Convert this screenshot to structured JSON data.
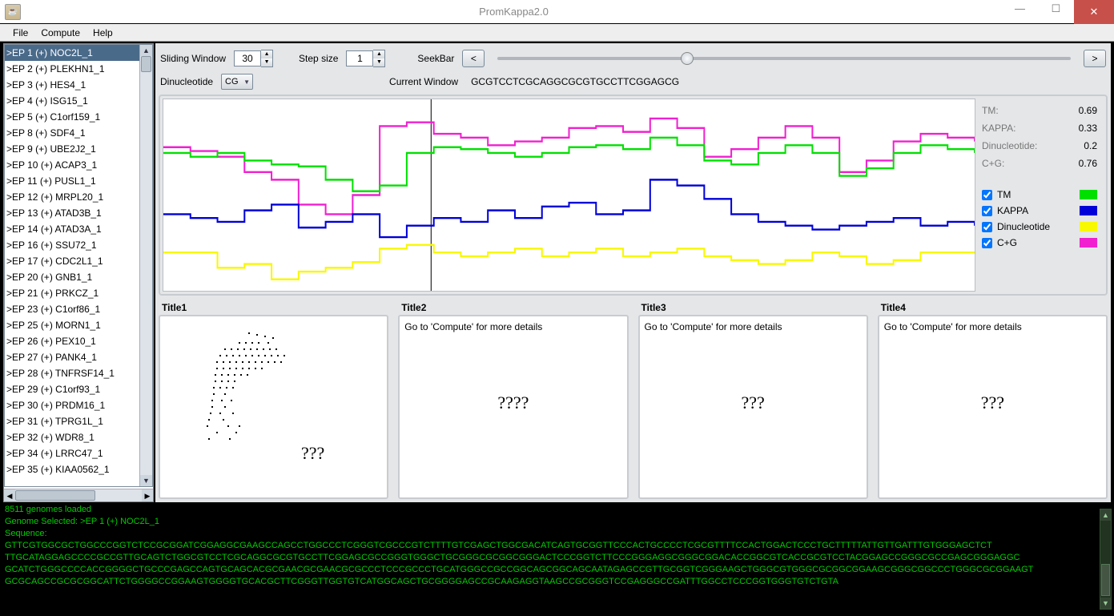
{
  "window": {
    "title": "PromKappa2.0"
  },
  "menu": {
    "file": "File",
    "compute": "Compute",
    "help": "Help"
  },
  "sidebar": {
    "items": [
      ">EP 1 (+) NOC2L_1",
      ">EP 2 (+) PLEKHN1_1",
      ">EP 3 (+) HES4_1",
      ">EP 4 (+) ISG15_1",
      ">EP 5 (+) C1orf159_1",
      ">EP 8 (+) SDF4_1",
      ">EP 9 (+) UBE2J2_1",
      ">EP 10 (+) ACAP3_1",
      ">EP 11 (+) PUSL1_1",
      ">EP 12 (+) MRPL20_1",
      ">EP 13 (+) ATAD3B_1",
      ">EP 14 (+) ATAD3A_1",
      ">EP 16 (+) SSU72_1",
      ">EP 17 (+) CDC2L1_1",
      ">EP 20 (+) GNB1_1",
      ">EP 21 (+) PRKCZ_1",
      ">EP 23 (+) C1orf86_1",
      ">EP 25 (+) MORN1_1",
      ">EP 26 (+) PEX10_1",
      ">EP 27 (+) PANK4_1",
      ">EP 28 (+) TNFRSF14_1",
      ">EP 29 (+) C1orf93_1",
      ">EP 30 (+) PRDM16_1",
      ">EP 31 (+) TPRG1L_1",
      ">EP 32 (+) WDR8_1",
      ">EP 34 (+) LRRC47_1",
      ">EP 35 (+) KIAA0562_1"
    ],
    "selected_index": 0
  },
  "controls": {
    "sliding_window_label": "Sliding Window",
    "sliding_window_value": "30",
    "step_label": "Step size",
    "step_value": "1",
    "seek_label": "SeekBar",
    "seek_prev": "<",
    "seek_next": ">",
    "dinucleotide_label": "Dinucleotide",
    "dinucleotide_value": "CG",
    "current_window_label": "Current Window",
    "current_window_value": "GCGTCCTCGCAGGCGCGTGCCTTCGGAGCG"
  },
  "metrics": {
    "tm_label": "TM:",
    "tm_value": "0.69",
    "kappa_label": "KAPPA:",
    "kappa_value": "0.33",
    "dinuc_label": "Dinucleotide:",
    "dinuc_value": "0.2",
    "cg_label": "C+G:",
    "cg_value": "0.76"
  },
  "legend": {
    "tm": "TM",
    "kappa": "KAPPA",
    "dinuc": "Dinucleotide",
    "cg": "C+G",
    "tm_color": "#00e000",
    "kappa_color": "#0000d8",
    "dinuc_color": "#f8f800",
    "cg_color": "#f020d0"
  },
  "panels": {
    "t1": "Title1",
    "t2": "Title2",
    "t3": "Title3",
    "t4": "Title4",
    "msg": "Go to 'Compute' for more details",
    "q4": "????",
    "q3a": "???",
    "q3b": "???",
    "q3c": "???"
  },
  "console": {
    "l0": "8511 genomes loaded",
    "l1": "Genome Selected: >EP 1 (+) NOC2L_1",
    "l2": "Sequence:",
    "l3": "GTTCGTGGCGCTGGCCCGGTCTCCGCGGATCGGAGGCGAAGCCAGCCTGGCCCTCGGGTCGCCCGTCTTTTGTCGAGCTGGCGACATCAGTGCGGTTCCCACTGCCCCTCGCGTTTTCCACTGGACTCCCTGCTTTTTATTGTTGATTTGTGGGAGCTCT",
    "l4": "TTGCATAGGAGCCCCGCCGTTGCAGTCTGGCGTCCTCGCAGGCGCGTGCCTTCGGAGCGCCGGGTGGGCTGCGGGCGCGGCGGGACTCCCGGTCTTCCCGGGAGGCGGGCGGACACCGGCGTCACCGCGTCCTACGGAGCCGGGCGCCGAGCGGGAGGC",
    "l5": "GCATCTGGGCCCCACCGGGGCTGCCCGAGCCAGTGCAGCACGCGAACGCGAACGCGCCCTCCCGCCCTGCATGGGCCGCCGGCAGCGGCAGCAATAGAGCCGTTGCGGTCGGGAAGCTGGGCGTGGGCGCGGCGGAAGCGGGCGGCCCTGGGCGCGGAAGT",
    "l6": "GCGCAGCCGCGCGGCATTCTGGGGCCGGAAGTGGGGTGCACGCTTCGGGTTGGTGTCATGGCAGCTGCGGGGAGCCGCAAGAGGTAAGCCGCGGGTCCGAGGGCCGATTTGGCCTCCCGGTGGGTGTCTGTA"
  },
  "chart_data": {
    "type": "line",
    "xlim": [
      0,
      1000
    ],
    "ylim": [
      0,
      1
    ],
    "series": [
      {
        "name": "C+G",
        "color": "#f020d0",
        "values_approx": [
          0.75,
          0.73,
          0.7,
          0.62,
          0.58,
          0.45,
          0.4,
          0.5,
          0.86,
          0.88,
          0.82,
          0.8,
          0.76,
          0.78,
          0.8,
          0.85,
          0.86,
          0.83,
          0.9,
          0.85,
          0.7,
          0.74,
          0.8,
          0.86,
          0.8,
          0.62,
          0.68,
          0.78,
          0.82,
          0.8,
          0.78
        ]
      },
      {
        "name": "TM",
        "color": "#00e000",
        "values_approx": [
          0.72,
          0.7,
          0.72,
          0.68,
          0.66,
          0.65,
          0.58,
          0.52,
          0.55,
          0.72,
          0.75,
          0.74,
          0.72,
          0.7,
          0.72,
          0.75,
          0.76,
          0.74,
          0.8,
          0.76,
          0.68,
          0.66,
          0.72,
          0.76,
          0.72,
          0.6,
          0.64,
          0.72,
          0.76,
          0.74,
          0.72
        ]
      },
      {
        "name": "KAPPA",
        "color": "#0000d8",
        "values_approx": [
          0.4,
          0.38,
          0.36,
          0.42,
          0.45,
          0.33,
          0.36,
          0.4,
          0.28,
          0.34,
          0.38,
          0.36,
          0.42,
          0.38,
          0.44,
          0.46,
          0.4,
          0.42,
          0.58,
          0.55,
          0.48,
          0.4,
          0.36,
          0.34,
          0.32,
          0.34,
          0.36,
          0.38,
          0.34,
          0.36,
          0.34
        ]
      },
      {
        "name": "Dinucleotide",
        "color": "#f8f800",
        "values_approx": [
          0.2,
          0.2,
          0.12,
          0.14,
          0.06,
          0.1,
          0.12,
          0.15,
          0.22,
          0.24,
          0.2,
          0.18,
          0.2,
          0.22,
          0.18,
          0.2,
          0.22,
          0.18,
          0.2,
          0.22,
          0.18,
          0.16,
          0.14,
          0.16,
          0.2,
          0.18,
          0.14,
          0.16,
          0.2,
          0.2,
          0.2
        ]
      }
    ]
  }
}
